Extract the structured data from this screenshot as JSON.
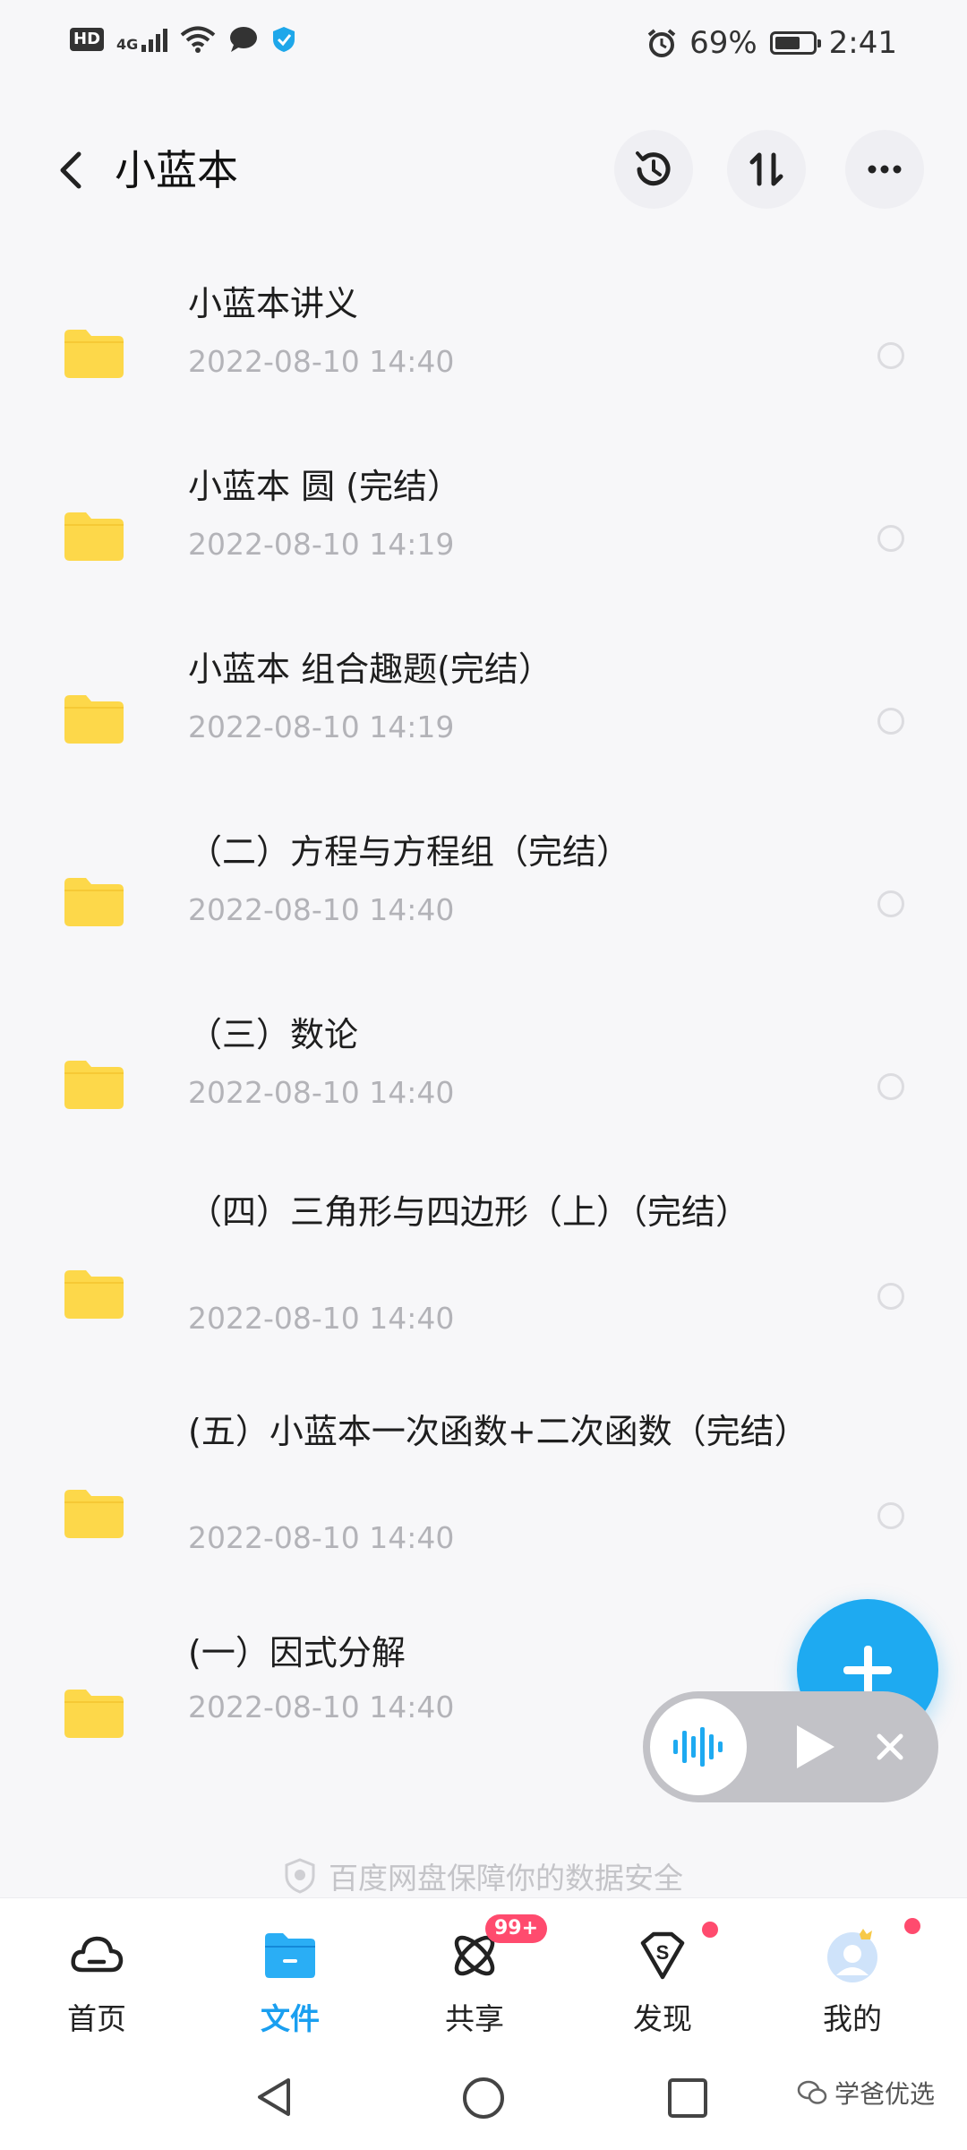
{
  "status_bar": {
    "hd": "HD",
    "network": "4G",
    "battery_percent_text": "69%",
    "battery_level": 0.69,
    "time": "2:41"
  },
  "header": {
    "title": "小蓝本"
  },
  "files": [
    {
      "name": "小蓝本讲义",
      "date": "2022-08-10  14:40"
    },
    {
      "name": "小蓝本 圆 (完结）",
      "date": "2022-08-10  14:19"
    },
    {
      "name": "小蓝本 组合趣题(完结）",
      "date": "2022-08-10  14:19"
    },
    {
      "name": "（二）方程与方程组（完结）",
      "date": "2022-08-10  14:40"
    },
    {
      "name": "（三）数论",
      "date": "2022-08-10  14:40"
    },
    {
      "name": "（四）三角形与四边形（上）（完结）",
      "date": "2022-08-10  14:40"
    },
    {
      "name": "(五）小蓝本一次函数+二次函数（完结）",
      "date": "2022-08-10  14:40"
    },
    {
      "name": "(一）因式分解",
      "date": "2022-08-10  14:40"
    }
  ],
  "security_note": "百度网盘保障你的数据安全",
  "bottom_nav": {
    "home": "首页",
    "files": "文件",
    "share": "共享",
    "share_badge": "99+",
    "discover": "发现",
    "mine": "我的"
  },
  "watermark": "学爸优选",
  "colors": {
    "accent": "#1eaaf1",
    "folder": "#fdd84a",
    "badge": "#ff4b6e"
  }
}
